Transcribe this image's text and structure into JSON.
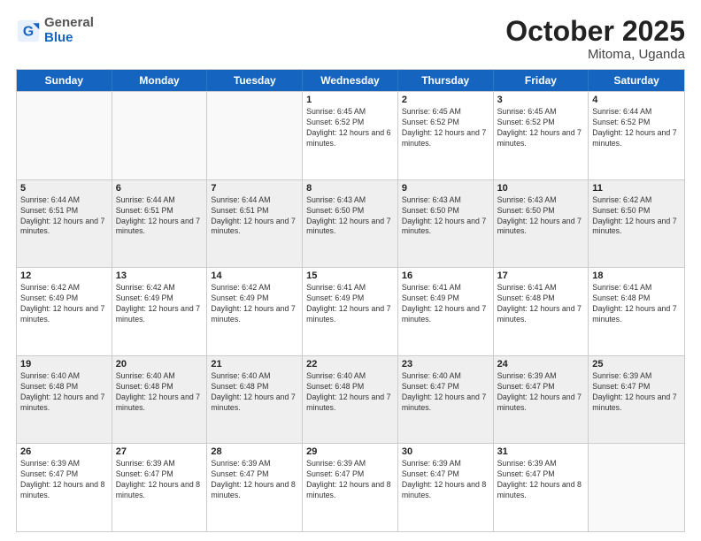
{
  "header": {
    "logo_general": "General",
    "logo_blue": "Blue",
    "month_title": "October 2025",
    "location": "Mitoma, Uganda"
  },
  "days_of_week": [
    "Sunday",
    "Monday",
    "Tuesday",
    "Wednesday",
    "Thursday",
    "Friday",
    "Saturday"
  ],
  "rows": [
    [
      {
        "day": "",
        "empty": true
      },
      {
        "day": "",
        "empty": true
      },
      {
        "day": "",
        "empty": true
      },
      {
        "day": "1",
        "sunrise": "6:45 AM",
        "sunset": "6:52 PM",
        "daylight": "12 hours and 6 minutes."
      },
      {
        "day": "2",
        "sunrise": "6:45 AM",
        "sunset": "6:52 PM",
        "daylight": "12 hours and 7 minutes."
      },
      {
        "day": "3",
        "sunrise": "6:45 AM",
        "sunset": "6:52 PM",
        "daylight": "12 hours and 7 minutes."
      },
      {
        "day": "4",
        "sunrise": "6:44 AM",
        "sunset": "6:52 PM",
        "daylight": "12 hours and 7 minutes."
      }
    ],
    [
      {
        "day": "5",
        "sunrise": "6:44 AM",
        "sunset": "6:51 PM",
        "daylight": "12 hours and 7 minutes."
      },
      {
        "day": "6",
        "sunrise": "6:44 AM",
        "sunset": "6:51 PM",
        "daylight": "12 hours and 7 minutes."
      },
      {
        "day": "7",
        "sunrise": "6:44 AM",
        "sunset": "6:51 PM",
        "daylight": "12 hours and 7 minutes."
      },
      {
        "day": "8",
        "sunrise": "6:43 AM",
        "sunset": "6:50 PM",
        "daylight": "12 hours and 7 minutes."
      },
      {
        "day": "9",
        "sunrise": "6:43 AM",
        "sunset": "6:50 PM",
        "daylight": "12 hours and 7 minutes."
      },
      {
        "day": "10",
        "sunrise": "6:43 AM",
        "sunset": "6:50 PM",
        "daylight": "12 hours and 7 minutes."
      },
      {
        "day": "11",
        "sunrise": "6:42 AM",
        "sunset": "6:50 PM",
        "daylight": "12 hours and 7 minutes."
      }
    ],
    [
      {
        "day": "12",
        "sunrise": "6:42 AM",
        "sunset": "6:49 PM",
        "daylight": "12 hours and 7 minutes."
      },
      {
        "day": "13",
        "sunrise": "6:42 AM",
        "sunset": "6:49 PM",
        "daylight": "12 hours and 7 minutes."
      },
      {
        "day": "14",
        "sunrise": "6:42 AM",
        "sunset": "6:49 PM",
        "daylight": "12 hours and 7 minutes."
      },
      {
        "day": "15",
        "sunrise": "6:41 AM",
        "sunset": "6:49 PM",
        "daylight": "12 hours and 7 minutes."
      },
      {
        "day": "16",
        "sunrise": "6:41 AM",
        "sunset": "6:49 PM",
        "daylight": "12 hours and 7 minutes."
      },
      {
        "day": "17",
        "sunrise": "6:41 AM",
        "sunset": "6:48 PM",
        "daylight": "12 hours and 7 minutes."
      },
      {
        "day": "18",
        "sunrise": "6:41 AM",
        "sunset": "6:48 PM",
        "daylight": "12 hours and 7 minutes."
      }
    ],
    [
      {
        "day": "19",
        "sunrise": "6:40 AM",
        "sunset": "6:48 PM",
        "daylight": "12 hours and 7 minutes."
      },
      {
        "day": "20",
        "sunrise": "6:40 AM",
        "sunset": "6:48 PM",
        "daylight": "12 hours and 7 minutes."
      },
      {
        "day": "21",
        "sunrise": "6:40 AM",
        "sunset": "6:48 PM",
        "daylight": "12 hours and 7 minutes."
      },
      {
        "day": "22",
        "sunrise": "6:40 AM",
        "sunset": "6:48 PM",
        "daylight": "12 hours and 7 minutes."
      },
      {
        "day": "23",
        "sunrise": "6:40 AM",
        "sunset": "6:47 PM",
        "daylight": "12 hours and 7 minutes."
      },
      {
        "day": "24",
        "sunrise": "6:39 AM",
        "sunset": "6:47 PM",
        "daylight": "12 hours and 7 minutes."
      },
      {
        "day": "25",
        "sunrise": "6:39 AM",
        "sunset": "6:47 PM",
        "daylight": "12 hours and 7 minutes."
      }
    ],
    [
      {
        "day": "26",
        "sunrise": "6:39 AM",
        "sunset": "6:47 PM",
        "daylight": "12 hours and 8 minutes."
      },
      {
        "day": "27",
        "sunrise": "6:39 AM",
        "sunset": "6:47 PM",
        "daylight": "12 hours and 8 minutes."
      },
      {
        "day": "28",
        "sunrise": "6:39 AM",
        "sunset": "6:47 PM",
        "daylight": "12 hours and 8 minutes."
      },
      {
        "day": "29",
        "sunrise": "6:39 AM",
        "sunset": "6:47 PM",
        "daylight": "12 hours and 8 minutes."
      },
      {
        "day": "30",
        "sunrise": "6:39 AM",
        "sunset": "6:47 PM",
        "daylight": "12 hours and 8 minutes."
      },
      {
        "day": "31",
        "sunrise": "6:39 AM",
        "sunset": "6:47 PM",
        "daylight": "12 hours and 8 minutes."
      },
      {
        "day": "",
        "empty": true
      }
    ]
  ],
  "labels": {
    "sunrise": "Sunrise:",
    "sunset": "Sunset:",
    "daylight": "Daylight:"
  }
}
